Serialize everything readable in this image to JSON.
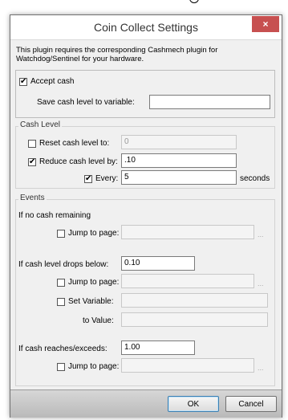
{
  "window": {
    "title": "Coin Collect Settings",
    "close_glyph": "×"
  },
  "intro_text": "This plugin requires the corresponding Cashmech plugin for Watchdog/Sentinel for your hardware.",
  "accept": {
    "checkbox_label": "Accept cash",
    "checked": true,
    "save_label": "Save cash level to variable:",
    "save_value": ""
  },
  "cash_level": {
    "legend": "Cash Level",
    "reset_label": "Reset cash level to:",
    "reset_checked": false,
    "reset_value": "0",
    "reduce_label": "Reduce cash level by:",
    "reduce_checked": true,
    "reduce_value": ".10",
    "every_label": "Every:",
    "every_checked": true,
    "every_value": "5",
    "every_unit": "seconds"
  },
  "events": {
    "legend": "Events",
    "no_cash": {
      "label": "If no cash remaining",
      "jump_label": "Jump to page:",
      "jump_value": "",
      "ellipsis": "..."
    },
    "drops_below": {
      "label": "If cash level drops below:",
      "value": "0.10",
      "jump_label": "Jump to page:",
      "jump_value": "",
      "ellipsis": "...",
      "set_var_label": "Set Variable:",
      "set_var_value": "",
      "to_value_label": "to Value:",
      "to_value_value": ""
    },
    "reaches": {
      "label": "If cash reaches/exceeds:",
      "value": "1.00",
      "jump_label": "Jump to page:",
      "jump_value": "",
      "ellipsis": "..."
    }
  },
  "buttons": {
    "ok": "OK",
    "cancel": "Cancel"
  },
  "colors": {
    "close_bg": "#c75050",
    "ok_border": "#3c7fb1"
  }
}
